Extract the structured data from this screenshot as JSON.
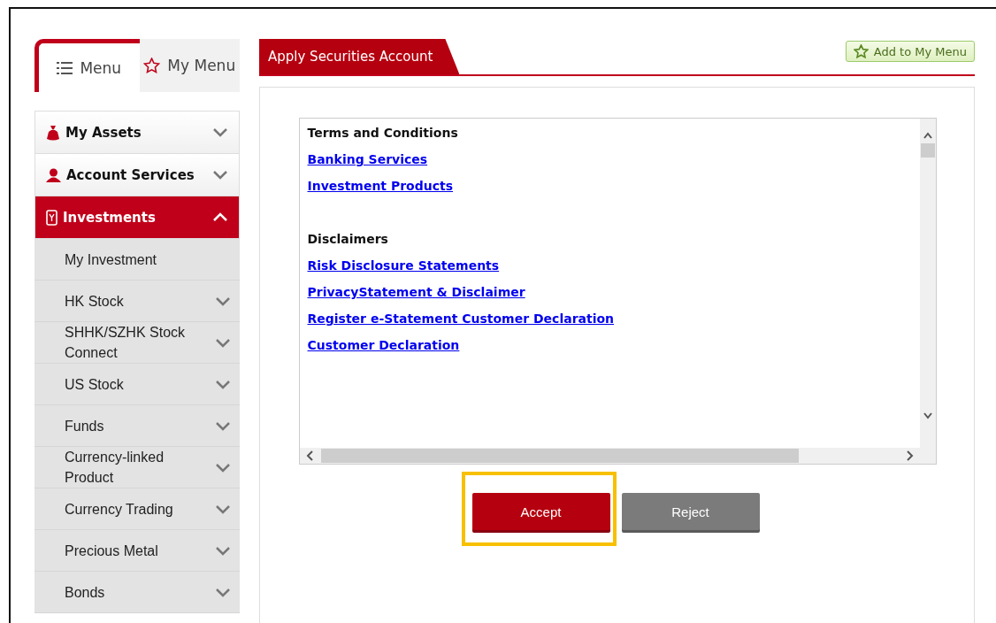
{
  "sidebar": {
    "tabs": [
      {
        "label": "Menu",
        "selected": true
      },
      {
        "label": "My Menu",
        "selected": false
      }
    ],
    "sections": [
      {
        "label": "My Assets",
        "expanded": false
      },
      {
        "label": "Account Services",
        "expanded": false
      },
      {
        "label": "Investments",
        "expanded": true,
        "children": [
          {
            "label": "My Investment",
            "kind": "leaf"
          },
          {
            "label": "HK Stock",
            "kind": "folder"
          },
          {
            "label": "SHHK/SZHK Stock Connect",
            "kind": "folder"
          },
          {
            "label": "US Stock",
            "kind": "folder"
          },
          {
            "label": "Funds",
            "kind": "folder"
          },
          {
            "label": "Currency-linked Product",
            "kind": "folder"
          },
          {
            "label": "Currency Trading",
            "kind": "folder"
          },
          {
            "label": "Precious Metal",
            "kind": "folder"
          },
          {
            "label": "Bonds",
            "kind": "folder"
          }
        ]
      }
    ]
  },
  "page": {
    "title": "Apply Securities Account",
    "add_button": "Add to My Menu",
    "terms": [
      {
        "kind": "heading",
        "text": "Terms and Conditions"
      },
      {
        "kind": "link",
        "text": "Banking Services"
      },
      {
        "kind": "link",
        "text": "Investment Products"
      },
      {
        "kind": "heading",
        "text": "Disclaimers"
      },
      {
        "kind": "link",
        "text": "Risk Disclosure Statements"
      },
      {
        "kind": "link",
        "text": "PrivacyStatement & Disclaimer "
      },
      {
        "kind": "link",
        "text": "Register e-Statement Customer Declaration"
      },
      {
        "kind": "link",
        "text": "Customer Declaration"
      }
    ],
    "buttons": [
      {
        "label": "Accept",
        "kind": "primary",
        "highlighted": true
      },
      {
        "label": "Reject",
        "kind": "secondary",
        "highlighted": false
      }
    ]
  }
}
